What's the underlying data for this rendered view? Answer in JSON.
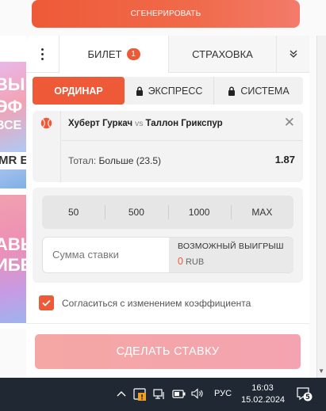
{
  "background": {
    "top_button_label": "СГЕНЕРИРОВАТЬ",
    "promo1_lines": [
      "ВЫ",
      "ЭФ",
      "ВСЕ",
      "MR EU"
    ],
    "promo2_lines": [
      "АВЬ",
      "ИБЕ"
    ]
  },
  "tabs": {
    "ticket_label": "БИЛЕТ",
    "ticket_count": "1",
    "insurance_label": "СТРАХОВКА"
  },
  "bet_types": [
    "ОРДИНАР",
    "ЭКСПРЕСС",
    "СИСТЕМА"
  ],
  "bet": {
    "player1": "Хуберт Гуркач",
    "vs": "vs",
    "player2": "Таллон Грикспур",
    "market_label": "Тотал:",
    "market_value": "Больше (23.5)",
    "odds": "1.87"
  },
  "stake": {
    "quick_amounts": [
      "50",
      "500",
      "1000",
      "MAX"
    ],
    "amount_placeholder": "Сумма ставки",
    "possible_win_label": "ВОЗМОЖНЫЙ ВЫИГРЫШ",
    "possible_win_value": "0",
    "currency": "RUB"
  },
  "agree_label": "Согласиться с изменением коэффициента",
  "place_bet_label": "СДЕЛАТЬ СТАВКУ",
  "taskbar": {
    "language": "РУС",
    "time": "16:03",
    "date": "15.02.2024",
    "notification_count": "5"
  },
  "colors": {
    "accent": "#ee5a38",
    "place_bet_disabled": "#f4a6a8",
    "taskbar": "#1f2833"
  }
}
